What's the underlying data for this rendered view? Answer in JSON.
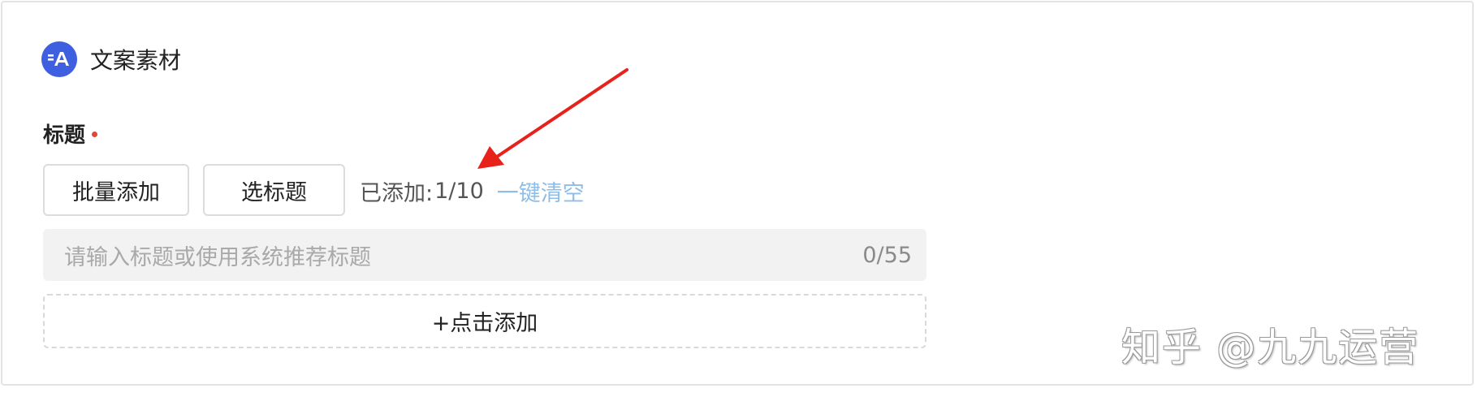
{
  "section": {
    "title": "文案素材",
    "icon": "wenan-logo-icon",
    "accent_color": "#3d5fe0"
  },
  "field": {
    "label": "标题",
    "required_color": "#e0483b"
  },
  "buttons": {
    "batch_add": "批量添加",
    "select_title": "选标题"
  },
  "added": {
    "prefix": "已添加:",
    "count": "1/10",
    "clear": "一键清空",
    "clear_color": "#8fbde6"
  },
  "input": {
    "placeholder": "请输入标题或使用系统推荐标题",
    "counter": "0/55"
  },
  "add_row": {
    "label": "+点击添加"
  },
  "watermark": {
    "text": "知乎 @九九运营"
  },
  "annotation": {
    "arrow_color": "#e8221b"
  }
}
